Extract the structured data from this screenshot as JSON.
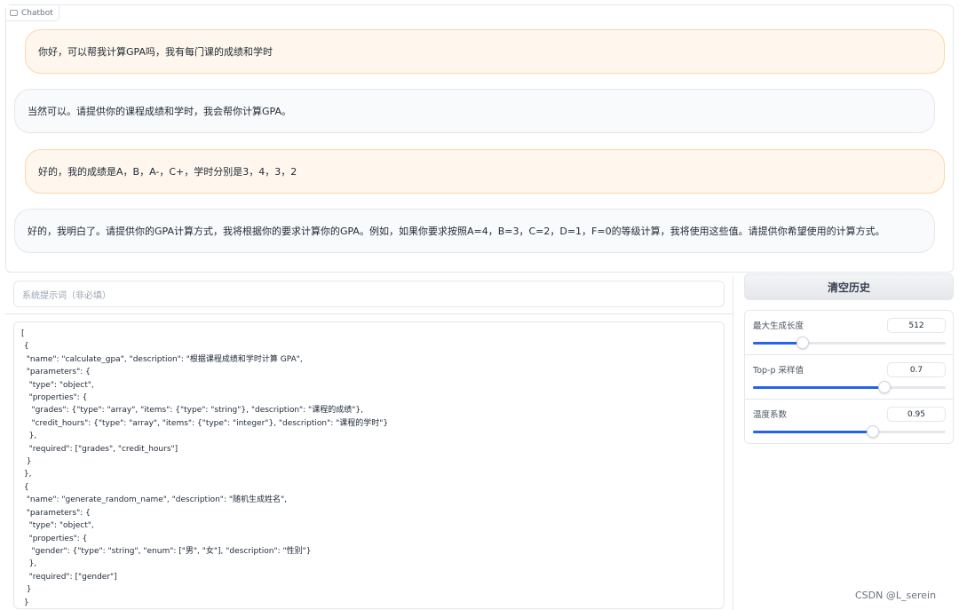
{
  "chatbot": {
    "label": "Chatbot",
    "messages": [
      {
        "role": "user",
        "text": "你好，可以帮我计算GPA吗，我有每门课的成绩和学时"
      },
      {
        "role": "assistant",
        "text": "当然可以。请提供你的课程成绩和学时，我会帮你计算GPA。"
      },
      {
        "role": "user",
        "text": "好的，我的成绩是A，B，A-，C+，学时分别是3，4，3，2"
      },
      {
        "role": "assistant",
        "text": "好的，我明白了。请提供你的GPA计算方式，我将根据你的要求计算你的GPA。例如，如果你要求按照A=4，B=3，C=2，D=1，F=0的等级计算，我将使用这些值。请提供你希望使用的计算方式。"
      }
    ]
  },
  "system_prompt": {
    "placeholder": "系统提示词（非必填）",
    "value": ""
  },
  "functions_code": {
    "lines": [
      "[",
      " {",
      "  \"name\": \"calculate_gpa\", \"description\": \"根据课程成绩和学时计算 GPA\",",
      "  \"parameters\": {",
      "   \"type\": \"object\",",
      "   \"properties\": {",
      "    \"grades\": {\"type\": \"array\", \"items\": {\"type\": \"string\"}, \"description\": \"课程的成绩\"},",
      "    \"credit_hours\": {\"type\": \"array\", \"items\": {\"type\": \"integer\"}, \"description\": \"课程的学时\"}",
      "   },",
      "   \"required\": [\"grades\", \"credit_hours\"]",
      "  }",
      " },",
      " {",
      "  \"name\": \"generate_random_name\", \"description\": \"随机生成姓名\",",
      "  \"parameters\": {",
      "   \"type\": \"object\",",
      "   \"properties\": {",
      "    \"gender\": {\"type\": \"string\", \"enum\": [\"男\", \"女\"], \"description\": \"性别\"}",
      "   },",
      "   \"required\": [\"gender\"]",
      "  }",
      " }"
    ]
  },
  "clear_history_label": "清空历史",
  "sliders": [
    {
      "label": "最大生成长度",
      "value": "512",
      "fraction": 0.26
    },
    {
      "label": "Top-p 采样值",
      "value": "0.7",
      "fraction": 0.68
    },
    {
      "label": "温度系数",
      "value": "0.95",
      "fraction": 0.62
    }
  ],
  "watermark": "CSDN @L_serein",
  "colors": {
    "accent": "#2563eb",
    "user_bubble": "#fff7ed",
    "user_bubble_border": "#fed7aa",
    "bot_bubble": "#f9fafb"
  }
}
